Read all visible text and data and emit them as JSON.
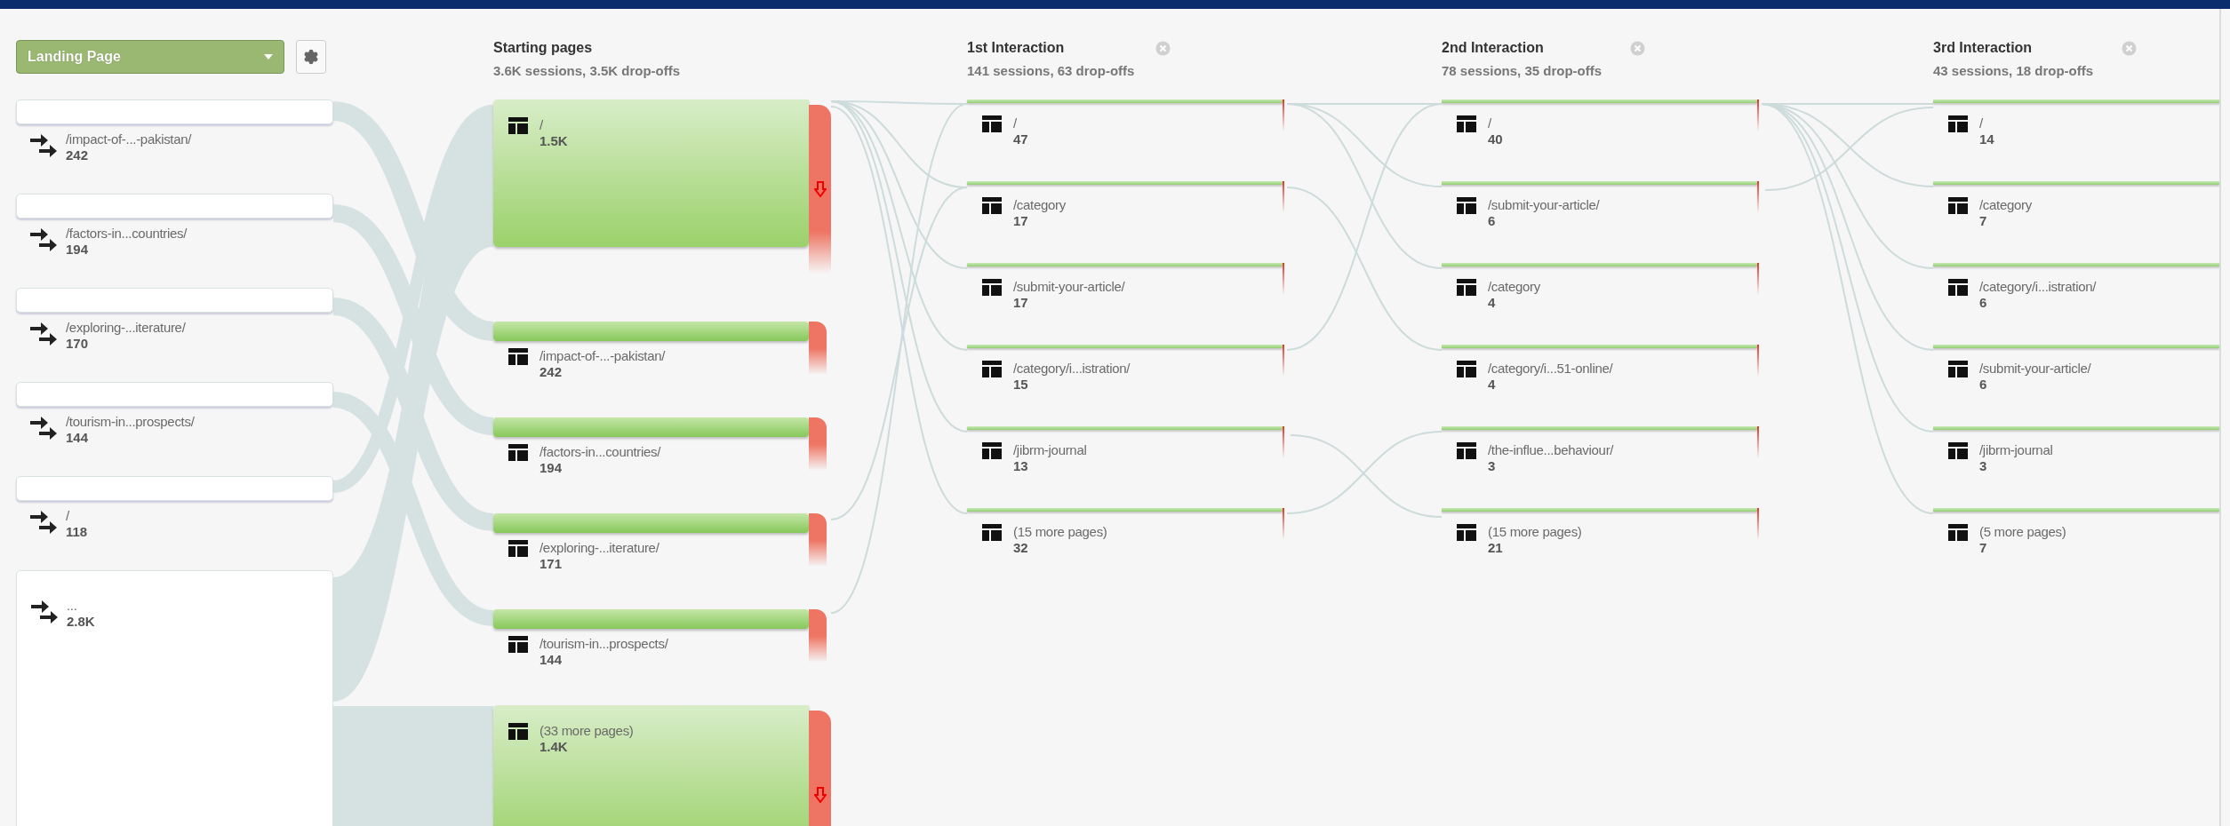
{
  "dimension_selector": {
    "label": "Landing Page"
  },
  "landing_pages": [
    {
      "kind": "bar",
      "label": "/impact-of-...-pakistan/",
      "count": "242"
    },
    {
      "kind": "bar",
      "label": "/factors-in...countries/",
      "count": "194"
    },
    {
      "kind": "bar",
      "label": "/exploring-...iterature/",
      "count": "170"
    },
    {
      "kind": "bar",
      "label": "/tourism-in...prospects/",
      "count": "144"
    },
    {
      "kind": "bar",
      "label": "/",
      "count": "118"
    },
    {
      "kind": "box",
      "label": "...",
      "count": "2.8K"
    }
  ],
  "steps": [
    {
      "title": "Starting pages",
      "subtitle": "3.6K sessions, 3.5K drop-offs",
      "closable": false,
      "nodes": [
        {
          "kind": "large",
          "label": "/",
          "count": "1.5K"
        },
        {
          "kind": "medium",
          "label": "/impact-of-...-pakistan/",
          "count": "242"
        },
        {
          "kind": "medium",
          "label": "/factors-in...countries/",
          "count": "194"
        },
        {
          "kind": "medium",
          "label": "/exploring-...iterature/",
          "count": "171"
        },
        {
          "kind": "medium",
          "label": "/tourism-in...prospects/",
          "count": "144"
        },
        {
          "kind": "large",
          "label": "(33 more pages)",
          "count": "1.4K"
        }
      ]
    },
    {
      "title": "1st Interaction",
      "subtitle": "141 sessions, 63 drop-offs",
      "closable": true,
      "nodes": [
        {
          "kind": "thin",
          "label": "/",
          "count": "47"
        },
        {
          "kind": "thin",
          "label": "/category",
          "count": "17"
        },
        {
          "kind": "thin",
          "label": "/submit-your-article/",
          "count": "17"
        },
        {
          "kind": "thin",
          "label": "/category/i...istration/",
          "count": "15"
        },
        {
          "kind": "thin",
          "label": "/jibrm-journal",
          "count": "13"
        },
        {
          "kind": "thin",
          "label": "(15 more pages)",
          "count": "32"
        }
      ]
    },
    {
      "title": "2nd Interaction",
      "subtitle": "78 sessions, 35 drop-offs",
      "closable": true,
      "nodes": [
        {
          "kind": "thin",
          "label": "/",
          "count": "40"
        },
        {
          "kind": "thin",
          "label": "/submit-your-article/",
          "count": "6"
        },
        {
          "kind": "thin",
          "label": "/category",
          "count": "4"
        },
        {
          "kind": "thin",
          "label": "/category/i...51-online/",
          "count": "4"
        },
        {
          "kind": "thin",
          "label": "/the-influe...behaviour/",
          "count": "3"
        },
        {
          "kind": "thin",
          "label": "(15 more pages)",
          "count": "21"
        }
      ]
    },
    {
      "title": "3rd Interaction",
      "subtitle": "43 sessions, 18 drop-offs",
      "closable": true,
      "nodes": [
        {
          "kind": "end",
          "label": "/",
          "count": "14"
        },
        {
          "kind": "end",
          "label": "/category",
          "count": "7"
        },
        {
          "kind": "end",
          "label": "/category/i...istration/",
          "count": "6"
        },
        {
          "kind": "end",
          "label": "/submit-your-article/",
          "count": "6"
        },
        {
          "kind": "end",
          "label": "/jibrm-journal",
          "count": "3"
        },
        {
          "kind": "end",
          "label": "(5 more pages)",
          "count": "7"
        }
      ]
    }
  ]
}
